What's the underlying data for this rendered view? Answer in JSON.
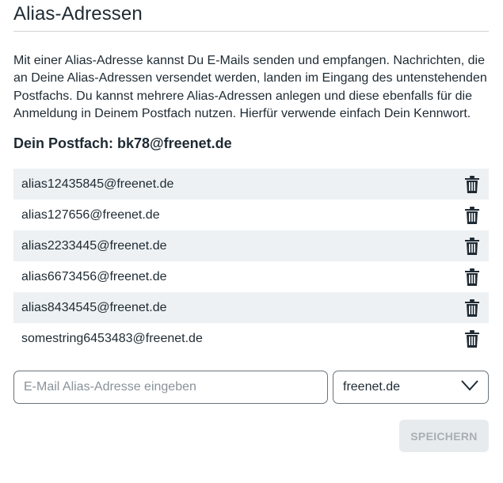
{
  "page": {
    "title": "Alias-Adressen",
    "intro": "Mit einer Alias-Adresse kannst Du E-Mails senden und empfangen. Nachrichten, die an Deine Alias-Adressen versendet werden, landen im Eingang des untenstehenden Postfachs. Du kannst mehrere Alias-Adressen anlegen und diese ebenfalls für die Anmeldung in Deinem Postfach nutzen. Hierfür verwende einfach Dein Kennwort.",
    "mailbox_label": "Dein Postfach: bk78@freenet.de"
  },
  "aliases": [
    {
      "address": "alias12435845@freenet.de",
      "action_icon": "trash-icon"
    },
    {
      "address": "alias127656@freenet.de",
      "action_icon": "trash-icon"
    },
    {
      "address": "alias2233445@freenet.de",
      "action_icon": "trash-icon"
    },
    {
      "address": "alias6673456@freenet.de",
      "action_icon": "trash-icon"
    },
    {
      "address": "alias8434545@freenet.de",
      "action_icon": "trash-icon"
    },
    {
      "address": "somestring6453483@freenet.de",
      "action_icon": "trash-icon"
    }
  ],
  "form": {
    "alias_input_value": "",
    "alias_input_placeholder": "E-Mail Alias-Adresse eingeben",
    "domain_selected": "freenet.de",
    "save_label": "SPEICHERN"
  },
  "colors": {
    "text": "#1e2a33",
    "row_stripe": "#eef1f3",
    "button_disabled_bg": "#e8ebed",
    "button_disabled_text": "#a8afb5"
  }
}
